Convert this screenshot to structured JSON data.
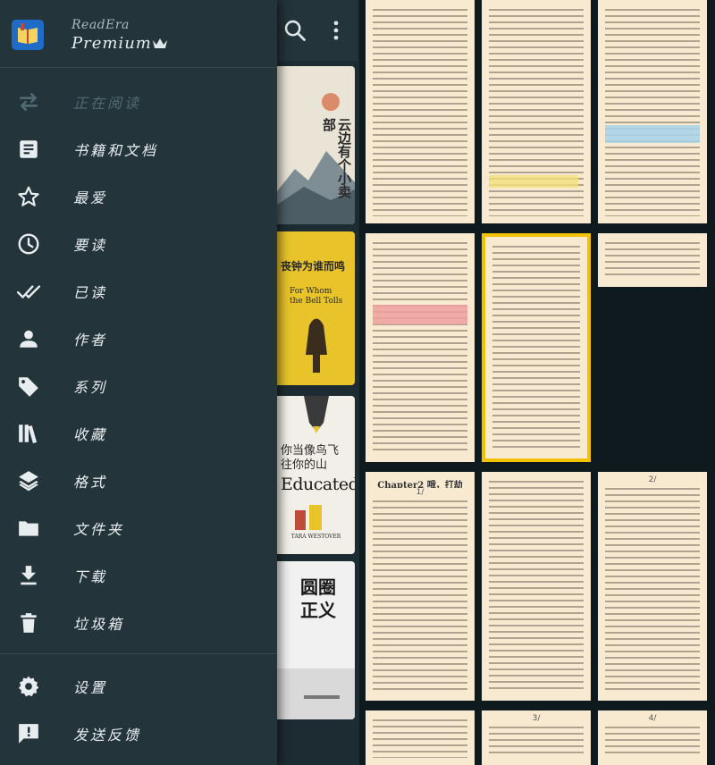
{
  "app": {
    "name": "ReadEra",
    "edition": "Premium",
    "brand_color": "#1e6cc8"
  },
  "menu": {
    "items": [
      {
        "label": "正在阅读",
        "icon": "swap-arrows-icon",
        "active": true
      },
      {
        "label": "书籍和文档",
        "icon": "document-icon"
      },
      {
        "label": "最爱",
        "icon": "star-icon"
      },
      {
        "label": "要读",
        "icon": "clock-icon"
      },
      {
        "label": "已读",
        "icon": "double-check-icon"
      },
      {
        "label": "作者",
        "icon": "person-icon"
      },
      {
        "label": "系列",
        "icon": "tag-icon"
      },
      {
        "label": "收藏",
        "icon": "bookshelf-icon"
      },
      {
        "label": "格式",
        "icon": "layers-icon"
      },
      {
        "label": "文件夹",
        "icon": "folder-icon"
      },
      {
        "label": "下载",
        "icon": "download-icon"
      },
      {
        "label": "垃圾箱",
        "icon": "trash-icon"
      }
    ],
    "footer_items": [
      {
        "label": "设置",
        "icon": "gear-icon"
      },
      {
        "label": "发送反馈",
        "icon": "feedback-icon"
      }
    ]
  },
  "toolbar": {
    "icons": [
      "search-icon",
      "more-vertical-icon"
    ]
  },
  "books": [
    {
      "title": "云边有个小卖部",
      "cover_color": "#e9e4d6"
    },
    {
      "title": "丧钟为谁而鸣",
      "subtitle": "For Whom the Bell Tolls",
      "cover_color": "#e8c42a"
    },
    {
      "title": "你当像鸟飞往你的山",
      "subtitle": "Educated",
      "author": "TARA WESTOVER",
      "cover_color": "#f2efe8"
    },
    {
      "title": "圆圈正义",
      "cover_color": "#f1f1f1"
    }
  ],
  "pages": {
    "chapter_title": "Chapter2 哦，打劫",
    "page_numbers": [
      "1/",
      "2/",
      "3/",
      "4/"
    ],
    "highlight_colors": {
      "blue": "#a8d4ec",
      "yellow": "#f2e07a",
      "red": "#f0a0a0"
    }
  }
}
